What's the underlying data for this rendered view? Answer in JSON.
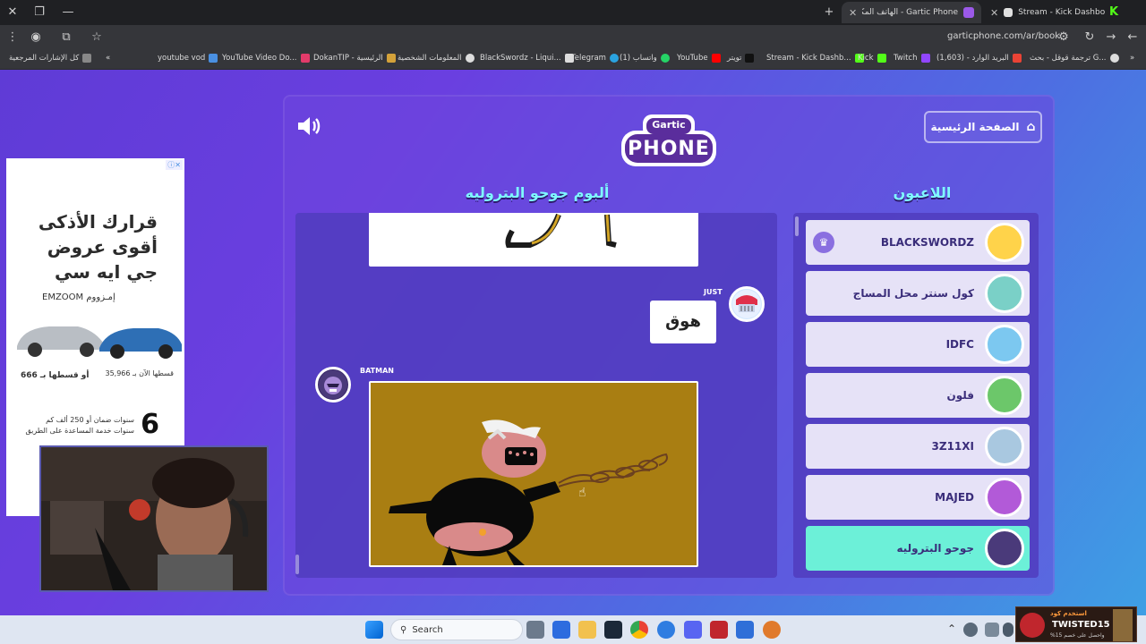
{
  "browser": {
    "tabs": [
      {
        "label": "Gartic Phone - الهاتف المكسور",
        "active": true
      },
      {
        "label": "Stream - Kick Dashboard",
        "active": false
      }
    ],
    "url": "garticphone.com/ar/book",
    "bookmarks": [
      "كل الإشارات المرجعية",
      "youtube vod",
      "YouTube Video Do...",
      "DokanTIP - الرئيسية",
      "المعلومات الشخصية",
      "BlackSwordz - Liqui...",
      "Telegram",
      "واتساب (1)",
      "YouTube",
      "تويتر",
      "Stream - Kick Dashb...",
      "Kick",
      "Twitch",
      "البريد الوارد - (1,603)",
      "ترجمة قوقل - بحث G..."
    ]
  },
  "game": {
    "home_label": "الصفحة الرئيسية",
    "logo_top": "Gartic",
    "logo_bottom": "PHONE",
    "album_title": "ألبوم جوحو البتروليه",
    "players_title": "اللاعبون",
    "entries": [
      {
        "author": "JUST",
        "text": "هوق"
      },
      {
        "author": "BATMAN"
      }
    ],
    "players": [
      {
        "name": "BLACKSWORDZ",
        "host": true
      },
      {
        "name": "كول سنتر محل المساج"
      },
      {
        "name": "IDFC"
      },
      {
        "name": "فلون"
      },
      {
        "name": "3Z11XI"
      },
      {
        "name": "MAJED"
      },
      {
        "name": "جوحو البتروليه",
        "me": true
      }
    ]
  },
  "ad": {
    "headline_1": "قرارك الأذكى",
    "headline_2": "أقوى عروض",
    "headline_3": "جي ايه سي",
    "brand": "EMZOOM إمـزووم",
    "price_1": "قسطها الآن بـ 35,966",
    "price_2": "أو قسطها بـ 666",
    "warranty_num": "6",
    "warranty_1": "سنوات ضمان أو 250 ألف كم",
    "warranty_2": "سنوات خدمة المساعدة على الطريق"
  },
  "taskbar": {
    "search_label": "Search"
  },
  "promo": {
    "line1": "استخدم كود",
    "code": "TWISTED15",
    "line3": "واحصل على خصم 15%"
  }
}
